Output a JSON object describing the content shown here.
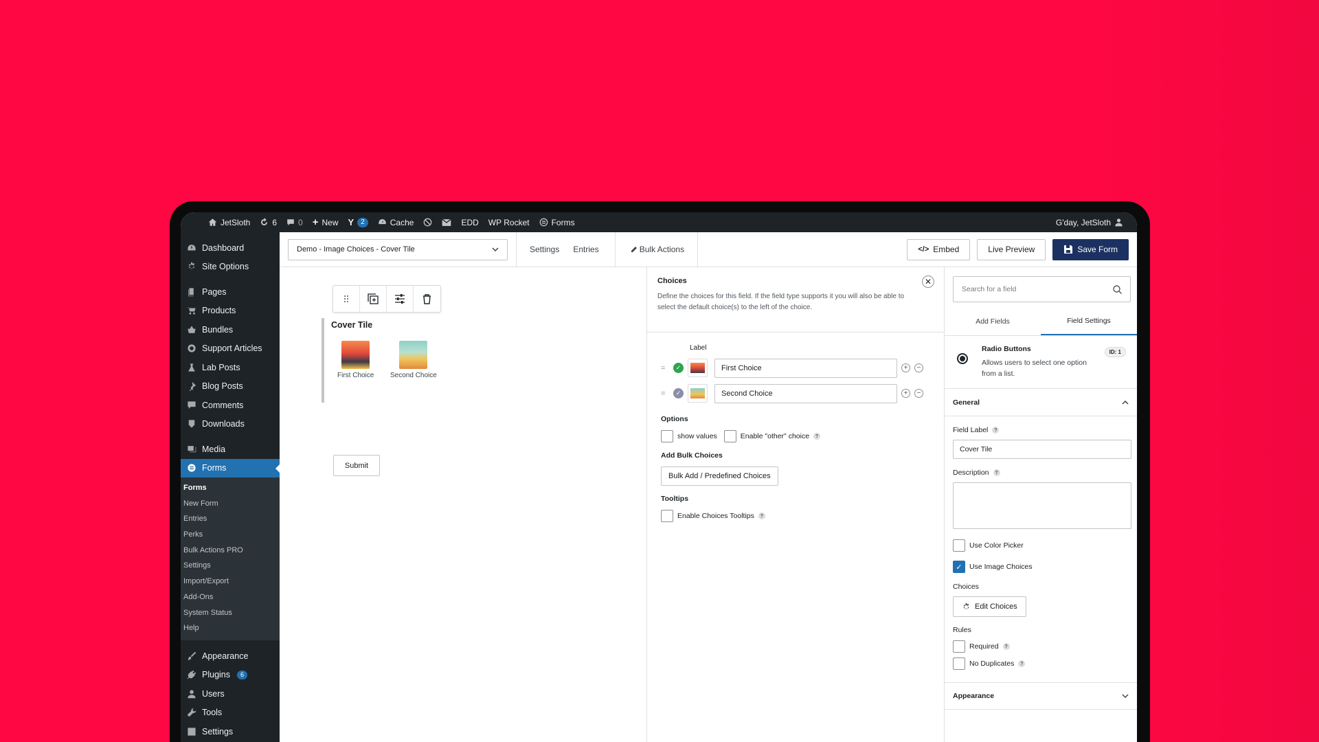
{
  "adminbar": {
    "site": "JetSloth",
    "updates": "6",
    "comments": "0",
    "new": "New",
    "yoast_count": "2",
    "cache": "Cache",
    "edd": "EDD",
    "wprocket": "WP Rocket",
    "forms": "Forms",
    "greeting": "G'day, JetSloth"
  },
  "sidebar": {
    "dashboard": "Dashboard",
    "site_options": "Site Options",
    "pages": "Pages",
    "products": "Products",
    "bundles": "Bundles",
    "support_articles": "Support Articles",
    "lab_posts": "Lab Posts",
    "blog_posts": "Blog Posts",
    "comments": "Comments",
    "downloads": "Downloads",
    "media": "Media",
    "forms": "Forms",
    "submenu": [
      "Forms",
      "New Form",
      "Entries",
      "Perks",
      "Bulk Actions PRO",
      "Settings",
      "Import/Export",
      "Add-Ons",
      "System Status",
      "Help"
    ],
    "appearance": "Appearance",
    "plugins": "Plugins",
    "plugins_count": "6",
    "users": "Users",
    "tools": "Tools",
    "settings": "Settings"
  },
  "toolbar": {
    "form_name": "Demo - Image Choices - Cover Tile",
    "settings": "Settings",
    "entries": "Entries",
    "bulk_actions": "Bulk Actions",
    "embed": "Embed",
    "live_preview": "Live Preview",
    "save": "Save Form"
  },
  "canvas": {
    "field_title": "Cover Tile",
    "choices": [
      "First Choice",
      "Second Choice"
    ],
    "submit": "Submit"
  },
  "choices_panel": {
    "title": "Choices",
    "description": "Define the choices for this field. If the field type supports it you will also be able to select the default choice(s) to the left of the choice.",
    "label_header": "Label",
    "choices": [
      "First Choice",
      "Second Choice"
    ],
    "options_label": "Options",
    "show_values": "show values",
    "enable_other": "Enable \"other\" choice",
    "bulk_label": "Add Bulk Choices",
    "bulk_button": "Bulk Add / Predefined Choices",
    "tooltips_label": "Tooltips",
    "enable_tooltips": "Enable Choices Tooltips",
    "colors": {
      "selected": "#2ea44f",
      "unselected": "#8c8faa"
    }
  },
  "right_panel": {
    "search_placeholder": "Search for a field",
    "tab_add": "Add Fields",
    "tab_settings": "Field Settings",
    "field_type": "Radio Buttons",
    "field_type_desc": "Allows users to select one option from a list.",
    "field_id": "ID: 1",
    "general": "General",
    "field_label_title": "Field Label",
    "field_label_value": "Cover Tile",
    "description_title": "Description",
    "use_color_picker": "Use Color Picker",
    "use_image_choices": "Use Image Choices",
    "choices_title": "Choices",
    "edit_choices": "Edit Choices",
    "rules_title": "Rules",
    "required": "Required",
    "no_duplicates": "No Duplicates",
    "appearance": "Appearance",
    "help_mark": "?"
  },
  "colors": {
    "background": "#ff0743",
    "save_button": "#1c3161",
    "admin_dark": "#1d2327",
    "wp_blue": "#2271b1"
  }
}
